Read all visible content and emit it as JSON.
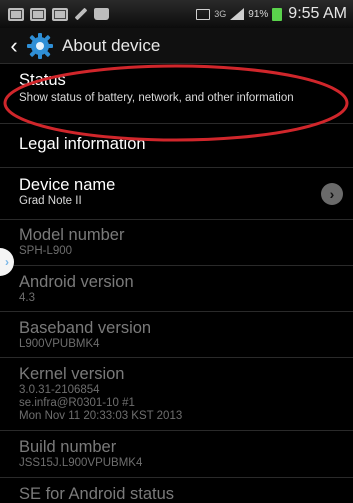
{
  "status_bar": {
    "network": "3G",
    "battery": "91%",
    "time": "9:55 AM"
  },
  "action_bar": {
    "title": "About device"
  },
  "items": [
    {
      "title": "Status",
      "summary": "Show status of battery, network, and other information",
      "enabled": true
    },
    {
      "title": "Legal information",
      "summary": "",
      "enabled": true
    },
    {
      "title": "Device name",
      "summary": "Grad Note II",
      "enabled": true
    },
    {
      "title": "Model number",
      "summary": "SPH-L900",
      "enabled": false
    },
    {
      "title": "Android version",
      "summary": "4.3",
      "enabled": false
    },
    {
      "title": "Baseband version",
      "summary": "L900VPUBMK4",
      "enabled": false
    },
    {
      "title": "Kernel version",
      "summary": "3.0.31-2106854\nse.infra@R0301-10 #1\nMon Nov 11 20:33:03 KST 2013",
      "enabled": false
    },
    {
      "title": "Build number",
      "summary": "JSS15J.L900VPUBMK4",
      "enabled": false
    },
    {
      "title": "SE for Android status",
      "summary": "",
      "enabled": false
    }
  ],
  "colors": {
    "background": "#000000",
    "annotation_circle": "#d0262b",
    "battery": "#5ad34c"
  }
}
